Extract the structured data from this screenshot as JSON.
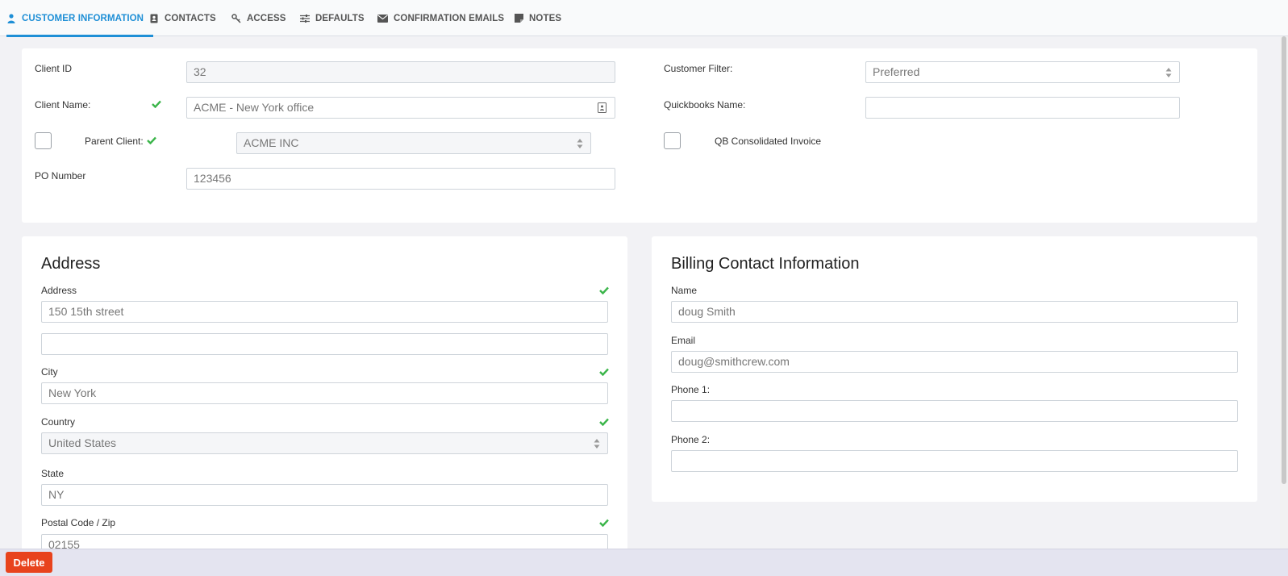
{
  "tabs": [
    {
      "label": "CUSTOMER INFORMATION",
      "icon": "user-icon",
      "active": true
    },
    {
      "label": "CONTACTS",
      "icon": "address-book-icon"
    },
    {
      "label": "ACCESS",
      "icon": "key-icon"
    },
    {
      "label": "DEFAULTS",
      "icon": "sliders-icon"
    },
    {
      "label": "CONFIRMATION EMAILS",
      "icon": "envelope-icon"
    },
    {
      "label": "NOTES",
      "icon": "note-icon"
    }
  ],
  "colors": {
    "accent": "#1f8fd6",
    "check": "#3bb54a",
    "danger": "#e8431d"
  },
  "customer": {
    "client_id_label": "Client ID",
    "client_id_value": "32",
    "client_name_label": "Client Name:",
    "client_name_value": "ACME - New York office",
    "parent_client_label": "Parent Client:",
    "parent_client_value": "ACME INC",
    "po_number_label": "PO Number",
    "po_number_value": "123456",
    "customer_filter_label": "Customer Filter:",
    "customer_filter_value": "Preferred",
    "quickbooks_name_label": "Quickbooks Name:",
    "quickbooks_name_value": "",
    "qb_consolidated_label": "QB Consolidated Invoice"
  },
  "address": {
    "title": "Address",
    "address_label": "Address",
    "address_line1": "150 15th street",
    "address_line2": "",
    "city_label": "City",
    "city_value": "New York",
    "country_label": "Country",
    "country_value": "United States",
    "state_label": "State",
    "state_value": "NY",
    "postal_label": "Postal Code / Zip",
    "postal_value": "02155"
  },
  "billing": {
    "title": "Billing Contact Information",
    "name_label": "Name",
    "name_value": "doug Smith",
    "email_label": "Email",
    "email_value": "doug@smithcrew.com",
    "phone1_label": "Phone 1:",
    "phone1_value": "",
    "phone2_label": "Phone 2:",
    "phone2_value": ""
  },
  "footer": {
    "delete_label": "Delete"
  }
}
